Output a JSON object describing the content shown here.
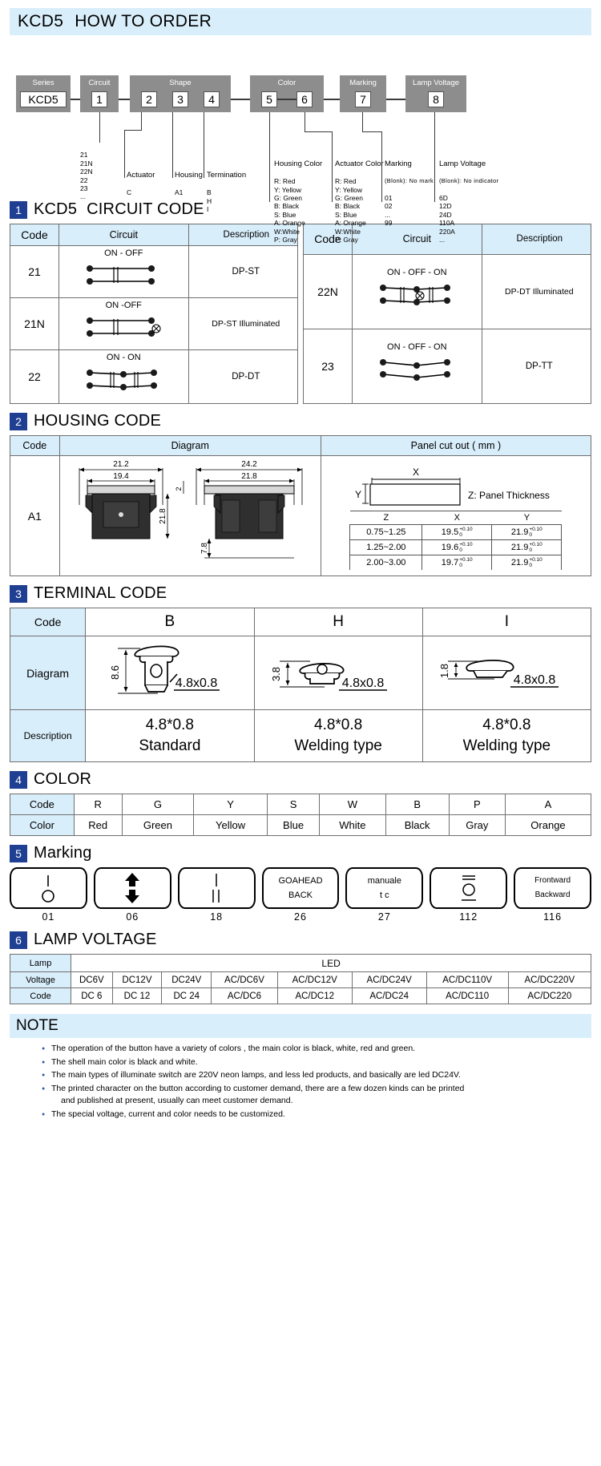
{
  "banner": {
    "series": "KCD5",
    "title": "HOW TO ORDER"
  },
  "order": {
    "boxes": [
      {
        "caption": "Series",
        "code": "KCD5"
      },
      {
        "caption": "Circuit",
        "code": "1"
      },
      {
        "caption": "Shape",
        "code": "2"
      },
      {
        "caption": "",
        "code": "3"
      },
      {
        "caption": "",
        "code": "4"
      },
      {
        "caption": "Color",
        "code": "5"
      },
      {
        "caption": "",
        "code": "6"
      },
      {
        "caption": "Marking",
        "code": "7"
      },
      {
        "caption": "Lamp Voltage",
        "code": "8"
      }
    ],
    "legends": [
      {
        "head": "",
        "lines": "21\n21N\n22N\n22\n23\n..."
      },
      {
        "head": "Actuator",
        "lines": "C"
      },
      {
        "head": "Housing",
        "lines": "A1"
      },
      {
        "head": "Termination",
        "lines": "B\nH\nI"
      },
      {
        "head": "Housing Color",
        "lines": "R: Red\nY: Yellow\nG: Green\nB: Black\nS: Blue\nA: Orange\nW:White\nP: Gray"
      },
      {
        "head": "Actuator Color",
        "lines": "R: Red\nY: Yellow\nG: Green\nB: Black\nS: Blue\nA: Orange\nW:White\nP: Gray"
      },
      {
        "head": "Marking",
        "blank": "(Blonk): No mark",
        "lines": "01\n02\n...\n99"
      },
      {
        "head": "Lamp Voltage",
        "blank": "(Blonk): No indicator",
        "lines": "6D\n12D\n24D\n110A\n220A\n..."
      }
    ]
  },
  "circuit": {
    "section_num": "1",
    "title_sub": "KCD5",
    "title": "CIRCUIT CODE",
    "headers": [
      "Code",
      "Circuit",
      "Description"
    ],
    "left_rows": [
      {
        "code": "21",
        "states": "ON - OFF",
        "description": "DP-ST",
        "illuminated": false,
        "throws": 1
      },
      {
        "code": "21N",
        "states": "ON -OFF",
        "description": "DP-ST Illuminated",
        "illuminated": true,
        "throws": 1
      },
      {
        "code": "22",
        "states": "ON    -    ON",
        "description": "DP-DT",
        "illuminated": false,
        "throws": 2
      }
    ],
    "right_rows": [
      {
        "code": "22N",
        "states": "ON  - OFF - ON",
        "description": "DP-DT Illuminated",
        "illuminated": true,
        "throws": 2
      },
      {
        "code": "23",
        "states": "ON  - OFF  - ON",
        "description": "DP-TT",
        "illuminated": false,
        "throws": 2
      }
    ]
  },
  "housing": {
    "section_num": "2",
    "title": "HOUSING CODE",
    "headers": [
      "Code",
      "Diagram",
      "Panel cut out ( mm )"
    ],
    "code": "A1",
    "dims_front": {
      "w_outer": "21.2",
      "w_inner": "19.4",
      "h": "21.8"
    },
    "dims_side": {
      "w_outer": "24.2",
      "w_inner": "21.8",
      "lip": "2",
      "depth": "7.8"
    },
    "cutout_note": "Z: Panel Thickness",
    "cutout_labels": {
      "x": "X",
      "y": "Y"
    },
    "cutout_headers": [
      "Z",
      "X",
      "Y"
    ],
    "cutout_rows": [
      {
        "z": "0.75~1.25",
        "x": "19.5",
        "x_tol_hi": "+0.10",
        "x_tol_lo": "0",
        "y": "21.9",
        "y_tol_hi": "+0.10",
        "y_tol_lo": "0"
      },
      {
        "z": "1.25~2.00",
        "x": "19.6",
        "x_tol_hi": "+0.10",
        "x_tol_lo": "0",
        "y": "21.9",
        "y_tol_hi": "+0.10",
        "y_tol_lo": "0"
      },
      {
        "z": "2.00~3.00",
        "x": "19.7",
        "x_tol_hi": "+0.10",
        "x_tol_lo": "0",
        "y": "21.9",
        "y_tol_hi": "+0.10",
        "y_tol_lo": "0"
      }
    ]
  },
  "terminal": {
    "section_num": "3",
    "title": "TERMINAL CODE",
    "row_labels": [
      "Code",
      "Diagram",
      "Description"
    ],
    "columns": [
      {
        "code": "B",
        "dim": "8.6",
        "size": "4.8x0.8",
        "desc1": "4.8*0.8",
        "desc2": "Standard"
      },
      {
        "code": "H",
        "dim": "3.8",
        "size": "4.8x0.8",
        "desc1": "4.8*0.8",
        "desc2": "Welding type"
      },
      {
        "code": "I",
        "dim": "1.8",
        "size": "4.8x0.8",
        "desc1": "4.8*0.8",
        "desc2": "Welding type"
      }
    ]
  },
  "color": {
    "section_num": "4",
    "title": "COLOR",
    "row_labels": [
      "Code",
      "Color"
    ],
    "codes": [
      "R",
      "G",
      "Y",
      "S",
      "W",
      "B",
      "P",
      "A"
    ],
    "names": [
      "Red",
      "Green",
      "Yellow",
      "Blue",
      "White",
      "Black",
      "Gray",
      "Orange"
    ]
  },
  "marking": {
    "section_num": "5",
    "title": "Marking",
    "items": [
      {
        "code": "01",
        "kind": "bar-circle",
        "top": "",
        "bottom": ""
      },
      {
        "code": "06",
        "kind": "arrows",
        "top": "",
        "bottom": ""
      },
      {
        "code": "18",
        "kind": "one-two-bars",
        "top": "",
        "bottom": ""
      },
      {
        "code": "26",
        "kind": "text",
        "top": "GOAHEAD",
        "bottom": "BACK"
      },
      {
        "code": "27",
        "kind": "text",
        "top": "manuale",
        "bottom": "t  c"
      },
      {
        "code": "112",
        "kind": "eq-circle",
        "top": "",
        "bottom": ""
      },
      {
        "code": "116",
        "kind": "text",
        "top": "Frontward",
        "bottom": "Backward"
      }
    ]
  },
  "lamp": {
    "section_num": "6",
    "title": "LAMP VOLTAGE",
    "group_header": "LED",
    "row_labels": [
      "Lamp",
      "Voltage",
      "Code"
    ],
    "voltages": [
      "DC6V",
      "DC12V",
      "DC24V",
      "AC/DC6V",
      "AC/DC12V",
      "AC/DC24V",
      "AC/DC110V",
      "AC/DC220V"
    ],
    "codes": [
      "DC 6",
      "DC 12",
      "DC 24",
      "AC/DC6",
      "AC/DC12",
      "AC/DC24",
      "AC/DC110",
      "AC/DC220"
    ]
  },
  "note": {
    "title": "NOTE",
    "items": [
      "The operation of the button have a variety of colors , the main color is black, white, red and green.",
      "The shell main color is black and white.",
      "The main types of illuminate switch are 220V neon lamps, and less led products, and basically are  led DC24V.",
      "The printed character on the button according to customer demand, there are a few dozen kinds can be printed",
      "The special voltage, current and color needs to be customized."
    ],
    "item4_cont": "and published at present,  usually can meet customer demand."
  },
  "colors": {
    "banner_bg": "#d9eefb",
    "section_badge": "#1f3f93",
    "order_box": "#8d8d8d",
    "table_header": "#d9eefb",
    "bullet": "#2b5fa8"
  }
}
